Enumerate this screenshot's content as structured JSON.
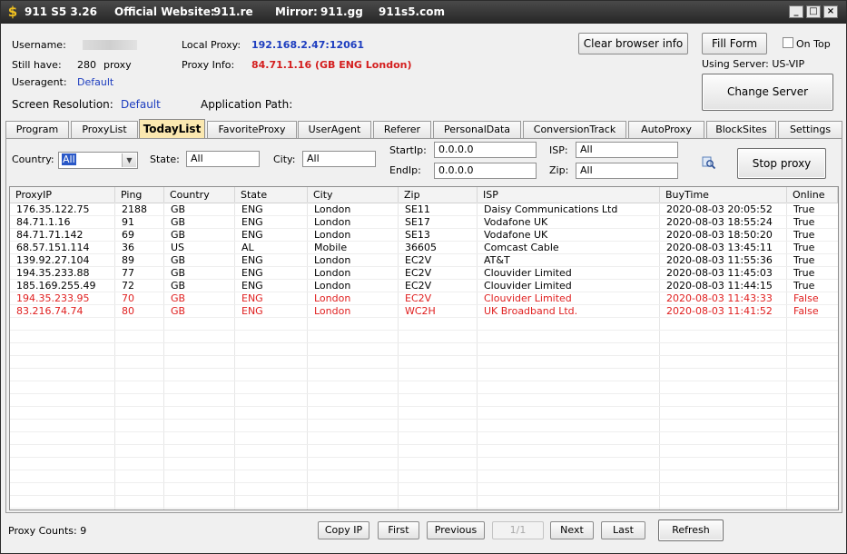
{
  "titlebar": {
    "app": "911 S5 3.26",
    "website_label": "Official Website:",
    "website": "911.re",
    "mirror_label": "Mirror:",
    "mirror": "911.gg",
    "alt_site": "911s5.com",
    "minimize": "_",
    "maximize": "□",
    "close": "×"
  },
  "info": {
    "username_label": "Username:",
    "still_have_label": "Still have:",
    "still_have_value": "280",
    "still_have_unit": "proxy",
    "useragent_label": "Useragent:",
    "useragent_value": "Default",
    "screen_res_label": "Screen Resolution:",
    "screen_res_value": "Default",
    "local_proxy_label": "Local Proxy:",
    "local_proxy_value": "192.168.2.47:12061",
    "proxy_info_label": "Proxy Info:",
    "proxy_info_value": "84.71.1.16 (GB ENG London)",
    "app_path_label": "Application Path:",
    "using_server": "Using Server: US-VIP"
  },
  "buttons": {
    "clear_browser": "Clear browser info",
    "fill_form": "Fill Form",
    "on_top": "On Top",
    "change_server": "Change Server",
    "stop_proxy": "Stop proxy"
  },
  "tabs": [
    "Program",
    "ProxyList",
    "TodayList",
    "FavoriteProxy",
    "UserAgent",
    "Referer",
    "PersonalData",
    "ConversionTrack",
    "AutoProxy",
    "BlockSites",
    "Settings"
  ],
  "active_tab": "TodayList",
  "filters": {
    "country_label": "Country:",
    "country_value": "All",
    "state_label": "State:",
    "state_value": "All",
    "city_label": "City:",
    "city_value": "All",
    "startip_label": "StartIp:",
    "startip_value": "0.0.0.0",
    "endip_label": "EndIp:",
    "endip_value": "0.0.0.0",
    "isp_label": "ISP:",
    "isp_value": "All",
    "zip_label": "Zip:",
    "zip_value": "All"
  },
  "table": {
    "columns": [
      "ProxyIP",
      "Ping",
      "Country",
      "State",
      "City",
      "Zip",
      "ISP",
      "BuyTime",
      "Online"
    ],
    "rows": [
      {
        "cells": [
          "176.35.122.75",
          "2188",
          "GB",
          "ENG",
          "London",
          "SE11",
          "Daisy Communications Ltd",
          "2020-08-03 20:05:52",
          "True"
        ],
        "offline": false
      },
      {
        "cells": [
          "84.71.1.16",
          "91",
          "GB",
          "ENG",
          "London",
          "SE17",
          "Vodafone UK",
          "2020-08-03 18:55:24",
          "True"
        ],
        "offline": false
      },
      {
        "cells": [
          "84.71.71.142",
          "69",
          "GB",
          "ENG",
          "London",
          "SE13",
          "Vodafone UK",
          "2020-08-03 18:50:20",
          "True"
        ],
        "offline": false
      },
      {
        "cells": [
          "68.57.151.114",
          "36",
          "US",
          "AL",
          "Mobile",
          "36605",
          "Comcast Cable",
          "2020-08-03 13:45:11",
          "True"
        ],
        "offline": false
      },
      {
        "cells": [
          "139.92.27.104",
          "89",
          "GB",
          "ENG",
          "London",
          "EC2V",
          "AT&T",
          "2020-08-03 11:55:36",
          "True"
        ],
        "offline": false
      },
      {
        "cells": [
          "194.35.233.88",
          "77",
          "GB",
          "ENG",
          "London",
          "EC2V",
          "Clouvider Limited",
          "2020-08-03 11:45:03",
          "True"
        ],
        "offline": false
      },
      {
        "cells": [
          "185.169.255.49",
          "72",
          "GB",
          "ENG",
          "London",
          "EC2V",
          "Clouvider Limited",
          "2020-08-03 11:44:15",
          "True"
        ],
        "offline": false
      },
      {
        "cells": [
          "194.35.233.95",
          "70",
          "GB",
          "ENG",
          "London",
          "EC2V",
          "Clouvider Limited",
          "2020-08-03 11:43:33",
          "False"
        ],
        "offline": true
      },
      {
        "cells": [
          "83.216.74.74",
          "80",
          "GB",
          "ENG",
          "London",
          "WC2H",
          "UK Broadband Ltd.",
          "2020-08-03 11:41:52",
          "False"
        ],
        "offline": true
      }
    ]
  },
  "footer": {
    "proxy_counts": "Proxy Counts: 9",
    "copy_ip": "Copy IP",
    "first": "First",
    "previous": "Previous",
    "page": "1/1",
    "next": "Next",
    "last": "Last",
    "refresh": "Refresh"
  },
  "colors": {
    "offline_row": "#e02020",
    "active_tab_bg": "#fbe8b0",
    "link_blue": "#1d3dbf"
  },
  "icons": {
    "app": "dollar-icon",
    "stop_proxy_side": "magnifier-icon"
  }
}
